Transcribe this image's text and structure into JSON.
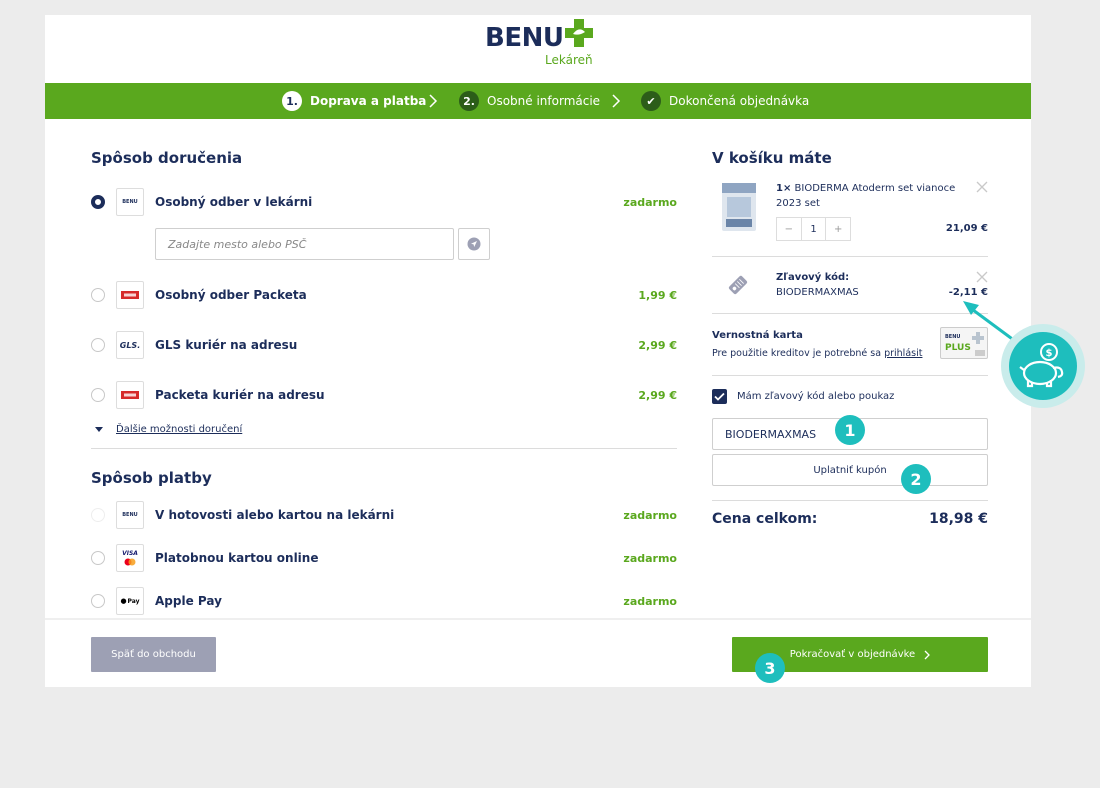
{
  "header": {
    "logo_text": "BENU",
    "logo_sub": "Lekáreň"
  },
  "steps": [
    {
      "num": "1.",
      "label": "Doprava a platba"
    },
    {
      "num": "2.",
      "label": "Osobné informácie"
    },
    {
      "num": "✔",
      "label": "Dokončená objednávka"
    }
  ],
  "delivery": {
    "title": "Spôsob doručenia",
    "options": [
      {
        "label": "Osobný odber v lekárni",
        "price": "zadarmo",
        "logo": "BENU"
      },
      {
        "label": "Osobný odber Packeta",
        "price": "1,99 €",
        "logo": "Packeta"
      },
      {
        "label": "GLS kuriér na adresu",
        "price": "2,99 €",
        "logo": "GLS."
      },
      {
        "label": "Packeta kuriér na adresu",
        "price": "2,99 €",
        "logo": "Packeta"
      }
    ],
    "city_placeholder": "Zadajte mesto alebo PSČ",
    "more_link": "Ďalšie možnosti doručení"
  },
  "payment": {
    "title": "Spôsob platby",
    "options": [
      {
        "label": "V hotovosti alebo kartou na lekárni",
        "price": "zadarmo",
        "logo": "BENU"
      },
      {
        "label": "Platobnou kartou online",
        "price": "zadarmo",
        "logo": "VISA"
      },
      {
        "label": "Apple Pay",
        "price": "zadarmo",
        "logo": "Pay"
      }
    ]
  },
  "cart": {
    "title": "V košíku máte",
    "item": {
      "qty_prefix": "1×",
      "name": "BIODERMA Atoderm set vianoce 2023 set",
      "qty": "1",
      "minus": "−",
      "plus": "+",
      "price": "21,09 €"
    },
    "coupon": {
      "label": "Zľavový kód:",
      "code": "BIODERMAXMAS",
      "discount": "-2,11 €"
    },
    "loyalty": {
      "title": "Vernostná karta",
      "text": "Pre použitie kreditov je potrebné sa",
      "link": "prihlásit"
    },
    "checkbox_label": "Mám zľavový kód alebo poukaz",
    "coupon_input_value": "BIODERMAXMAS",
    "apply_label": "Uplatniť kupón",
    "total_label": "Cena celkom:",
    "total_value": "18,98 €"
  },
  "footer": {
    "back_label": "Späť do obchodu",
    "continue_label": "Pokračovať v objednávke"
  },
  "markers": [
    "1",
    "2",
    "3"
  ],
  "colors": {
    "brand_green": "#5aa81e",
    "navy": "#1c2d5a",
    "teal_marker": "#1ebebd",
    "back_button": "#9da0b4"
  }
}
